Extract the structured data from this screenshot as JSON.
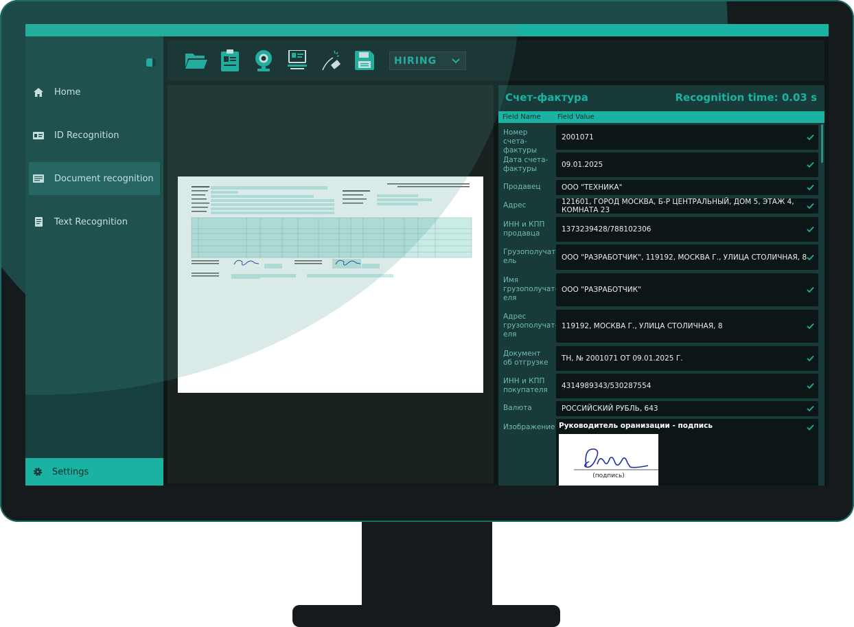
{
  "sidebar": {
    "items": [
      {
        "label": "Home",
        "icon": "home-icon"
      },
      {
        "label": "ID Recognition",
        "icon": "id-card-icon"
      },
      {
        "label": "Document recognition",
        "icon": "document-icon",
        "active": true
      },
      {
        "label": "Text Recognition",
        "icon": "text-icon"
      }
    ],
    "settings_label": "Settings"
  },
  "toolbar": {
    "tools": [
      "open-folder-icon",
      "clipboard-icon",
      "webcam-icon",
      "scan-id-icon",
      "wand-icon",
      "save-icon"
    ],
    "mode": "HIRING"
  },
  "results": {
    "title": "Счет-фактура",
    "time": "Recognition time: 0.03 s",
    "columns": {
      "name": "Field Name",
      "value": "Field Value"
    },
    "rows": [
      {
        "key": "Номер счета-фактуры",
        "value": "2001071"
      },
      {
        "key": "Дата счета-фактуры",
        "value": "09.01.2025"
      },
      {
        "key": "Продавец",
        "value": "ООО \"ТЕХНИКА\""
      },
      {
        "key": "Адрес",
        "value": "121601, ГОРОД МОСКВА, Б-Р ЦЕНТРАЛЬНЫЙ, ДОМ 5, ЭТАЖ 4, КОМНАТА 23"
      },
      {
        "key": "ИНН и КПП продавца",
        "value": "1373239428/788102306"
      },
      {
        "key": "Грузополучат-ель",
        "value": "ООО \"РАЗРАБОТЧИК\", 119192, МОСКВА Г., УЛИЦА СТОЛИЧНАЯ, 8"
      },
      {
        "key": "Имя грузополучат-еля",
        "value": "ООО \"РАЗРАБОТЧИК\""
      },
      {
        "key": "Адрес грузополучат-еля",
        "value": "119192, МОСКВА Г., УЛИЦА СТОЛИЧНАЯ, 8"
      },
      {
        "key": "Документ об отгрузке",
        "value": "ТН, № 2001071 ОТ 09.01.2025 Г."
      },
      {
        "key": "ИНН и КПП покупателя",
        "value": "4314989343/530287554"
      },
      {
        "key": "Валюта",
        "value": "РОССИЙСКИЙ РУБЛЬ, 643"
      }
    ],
    "image_row": {
      "key": "Изображение",
      "title": "Руководитель оранизации - подпись",
      "caption": "(подпись)"
    }
  },
  "colors": {
    "accent": "#1ab3a3",
    "sidebar": "#16403f",
    "panel": "#183a39",
    "check": "#1ab3a3"
  }
}
